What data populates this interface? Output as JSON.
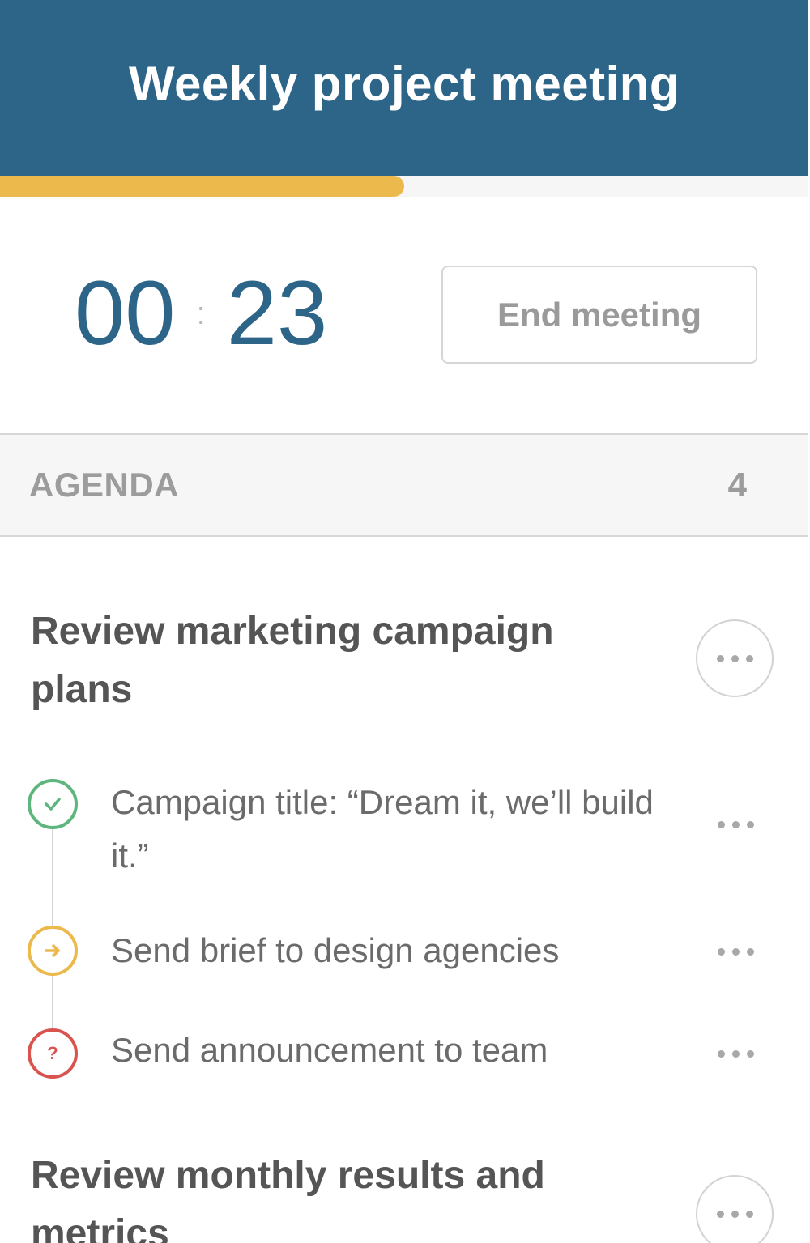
{
  "header": {
    "title": "Weekly project meeting"
  },
  "progress": {
    "fraction": 0.5,
    "color": "#ebb94c"
  },
  "timer": {
    "minutes": "00",
    "seconds": "23",
    "separator": ":"
  },
  "end_button": {
    "label": "End meeting"
  },
  "agenda": {
    "label": "AGENDA",
    "count": "4"
  },
  "topics": [
    {
      "title": "Review marketing campaign plans",
      "items": [
        {
          "text": "Campaign title: “Dream it, we’ll build it.”",
          "status": "done",
          "icon": "check-icon",
          "color": "#5eb57e"
        },
        {
          "text": "Send brief to design agencies",
          "status": "in-progress",
          "icon": "arrow-right-icon",
          "color": "#ebb94c"
        },
        {
          "text": "Send announcement to team",
          "status": "question",
          "icon": "question-icon",
          "color": "#d9534f"
        }
      ]
    },
    {
      "title": "Review monthly results and metrics",
      "items": []
    }
  ],
  "colors": {
    "header": "#2d6589",
    "accent": "#ebb94c",
    "done": "#5eb57e",
    "question": "#d9534f"
  }
}
